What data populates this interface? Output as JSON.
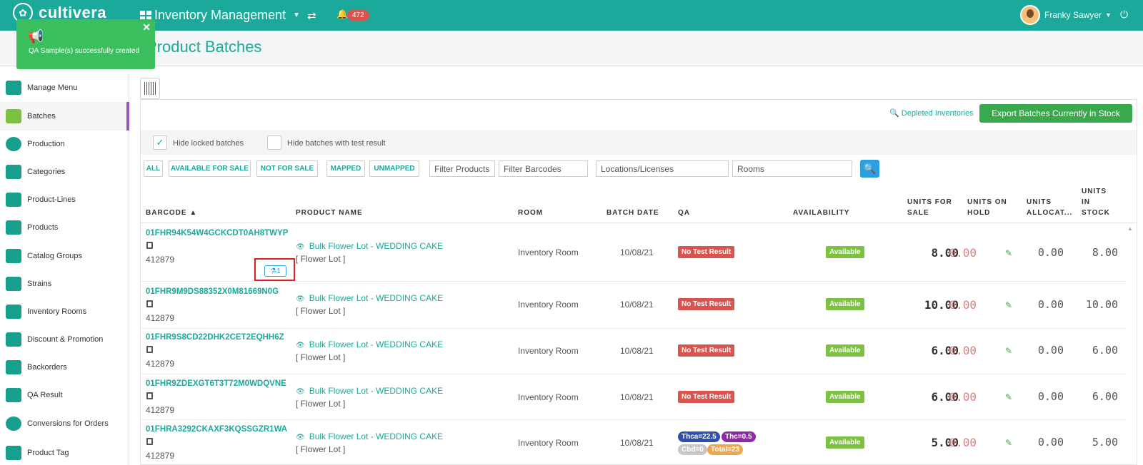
{
  "topbar": {
    "logo": "cultivera",
    "app_title": "Inventory Management",
    "notifications": "472",
    "user": "Franky Sawyer"
  },
  "toast": {
    "message": "QA Sample(s) successfully created"
  },
  "page": {
    "title": "Product Batches"
  },
  "sidebar": {
    "items": [
      {
        "label": "Manage Menu"
      },
      {
        "label": "Batches"
      },
      {
        "label": "Production"
      },
      {
        "label": "Categories"
      },
      {
        "label": "Product-Lines"
      },
      {
        "label": "Products"
      },
      {
        "label": "Catalog Groups"
      },
      {
        "label": "Strains"
      },
      {
        "label": "Inventory Rooms"
      },
      {
        "label": "Discount & Promotion"
      },
      {
        "label": "Backorders"
      },
      {
        "label": "QA Result"
      },
      {
        "label": "Conversions for Orders"
      },
      {
        "label": "Product Tag"
      }
    ]
  },
  "toolbar": {
    "depleted": "Depleted Inventories",
    "export": "Export Batches Currently in Stock",
    "hide_locked": "Hide locked batches",
    "hide_test": "Hide batches with test result"
  },
  "filters": {
    "all": "ALL",
    "available": "AVAILABLE FOR SALE",
    "not_for_sale": "NOT FOR SALE",
    "mapped": "MAPPED",
    "unmapped": "UNMAPPED",
    "products": "Filter Products",
    "barcodes": "Filter Barcodes",
    "locations": "Locations/Licenses",
    "rooms": "Rooms"
  },
  "table": {
    "headers": {
      "barcode": "BARCODE ▲",
      "product": "PRODUCT NAME",
      "room": "ROOM",
      "batch_date": "BATCH DATE",
      "qa": "QA",
      "availability": "AVAILABILITY",
      "units_sale_1": "UNITS FOR",
      "units_sale_2": "SALE",
      "units_hold_1": "UNITS ON",
      "units_hold_2": "HOLD",
      "units_alloc_1": "UNITS",
      "units_alloc_2": "ALLOCAT...",
      "units_stock_1": "UNITS",
      "units_stock_2": "IN",
      "units_stock_3": "STOCK"
    },
    "rows": [
      {
        "barcode": "01FHR94K54W4GCKCDT0AH8TWYP",
        "id": "412879",
        "product": "Bulk Flower Lot - WEDDING CAKE",
        "sub": "[ Flower Lot ]",
        "room": "Inventory Room",
        "date": "10/08/21",
        "qa": "No Test Result",
        "avail": "Available",
        "sale": "8.00",
        "hold": "0.00",
        "alloc": "0.00",
        "stock": "8.00",
        "sample": "1"
      },
      {
        "barcode": "01FHR9M9DS88352X0M81669N0G",
        "id": "412879",
        "product": "Bulk Flower Lot - WEDDING CAKE",
        "sub": "[ Flower Lot ]",
        "room": "Inventory Room",
        "date": "10/08/21",
        "qa": "No Test Result",
        "avail": "Available",
        "sale": "10.00",
        "hold": "0.00",
        "alloc": "0.00",
        "stock": "10.00"
      },
      {
        "barcode": "01FHR9S8CD22DHK2CET2EQHH6Z",
        "id": "412879",
        "product": "Bulk Flower Lot - WEDDING CAKE",
        "sub": "[ Flower Lot ]",
        "room": "Inventory Room",
        "date": "10/08/21",
        "qa": "No Test Result",
        "avail": "Available",
        "sale": "6.00",
        "hold": "0.00",
        "alloc": "0.00",
        "stock": "6.00"
      },
      {
        "barcode": "01FHR9ZDEXGT6T3T72M0WDQVNE",
        "id": "412879",
        "product": "Bulk Flower Lot - WEDDING CAKE",
        "sub": "[ Flower Lot ]",
        "room": "Inventory Room",
        "date": "10/08/21",
        "qa": "No Test Result",
        "avail": "Available",
        "sale": "6.00",
        "hold": "0.00",
        "alloc": "0.00",
        "stock": "6.00"
      },
      {
        "barcode": "01FHRA3292CKAXF3KQSSGZR1WA",
        "id": "412879",
        "product": "Bulk Flower Lot - WEDDING CAKE",
        "sub": "[ Flower Lot ]",
        "room": "Inventory Room",
        "date": "10/08/21",
        "qa_chips": [
          "Thca=22.5",
          "Thc=0.5",
          "Cbd=0",
          "Total=23"
        ],
        "avail": "Available",
        "sale": "5.00",
        "hold": "0.00",
        "alloc": "0.00",
        "stock": "5.00"
      }
    ]
  },
  "colors": {
    "brand": "#1aa99a",
    "export": "#3aa84d",
    "danger": "#d9534f",
    "available": "#7cc142"
  }
}
